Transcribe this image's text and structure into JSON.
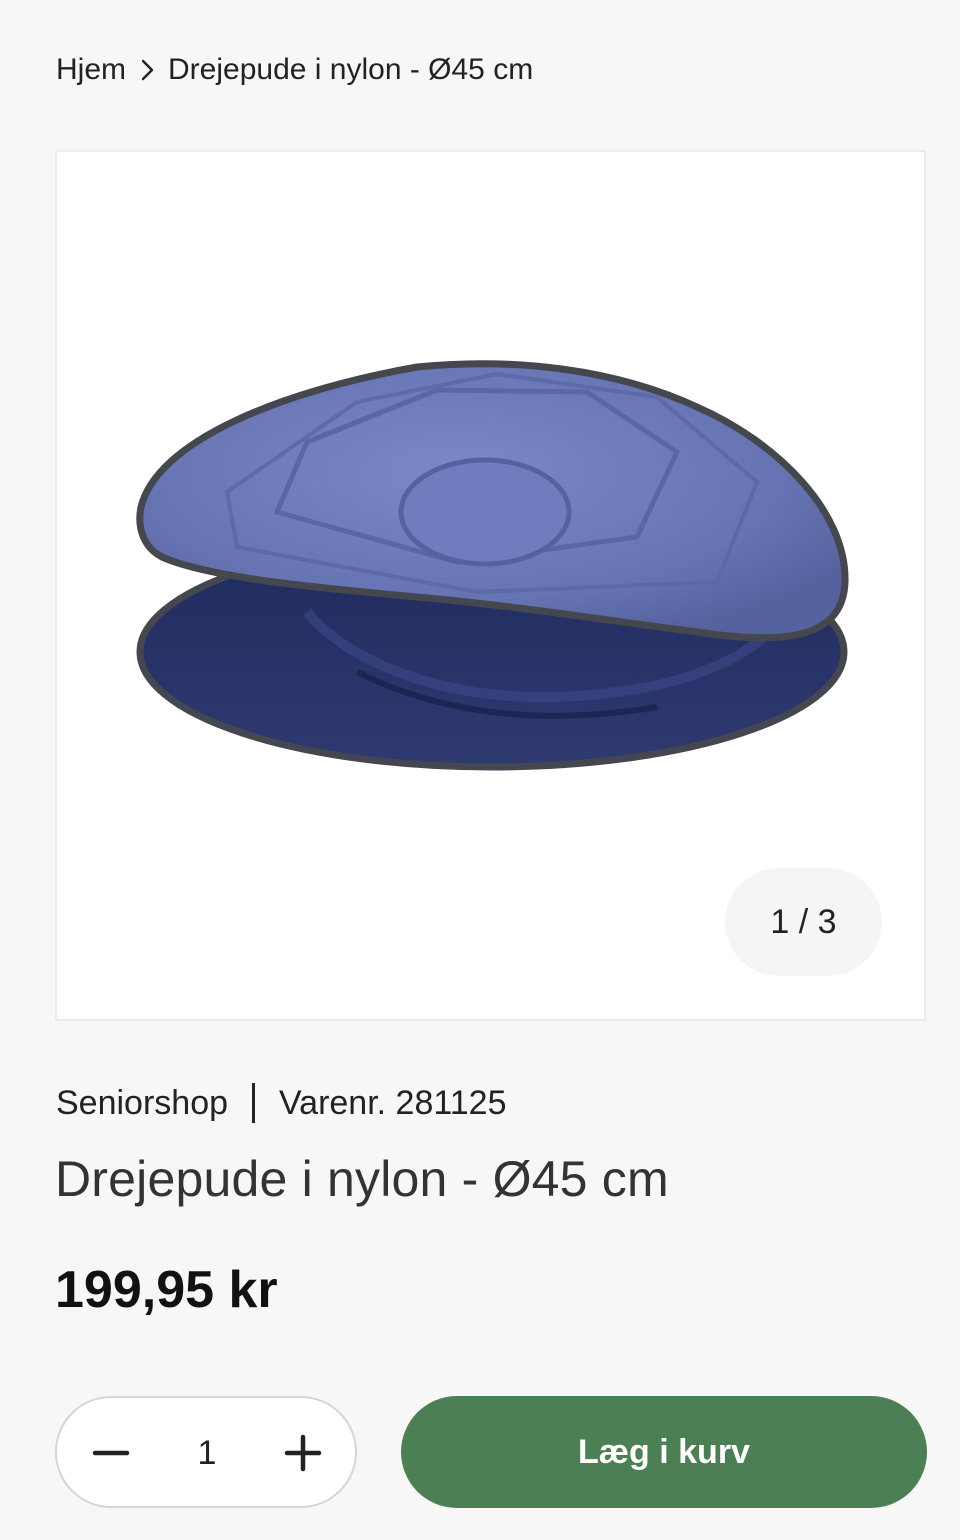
{
  "breadcrumb": {
    "home": "Hjem",
    "current": "Drejepude i nylon - Ø45 cm",
    "separator_icon": "chevron-right-icon"
  },
  "gallery": {
    "image_alt": "Drejepude i nylon - Ø45 cm",
    "counter": "1 / 3",
    "product_colors": {
      "cushion_top": "#6a78b8",
      "cushion_base": "#2b3569",
      "piping": "#4a4a55"
    }
  },
  "product": {
    "brand": "Seniorshop",
    "sku": "Varenr. 281125",
    "title": "Drejepude i nylon - Ø45 cm",
    "price": "199,95 kr"
  },
  "cart": {
    "quantity": "1",
    "minus_icon": "minus-icon",
    "plus_icon": "plus-icon",
    "add_label": "Læg i kurv",
    "accent_color": "#4d7f55"
  }
}
